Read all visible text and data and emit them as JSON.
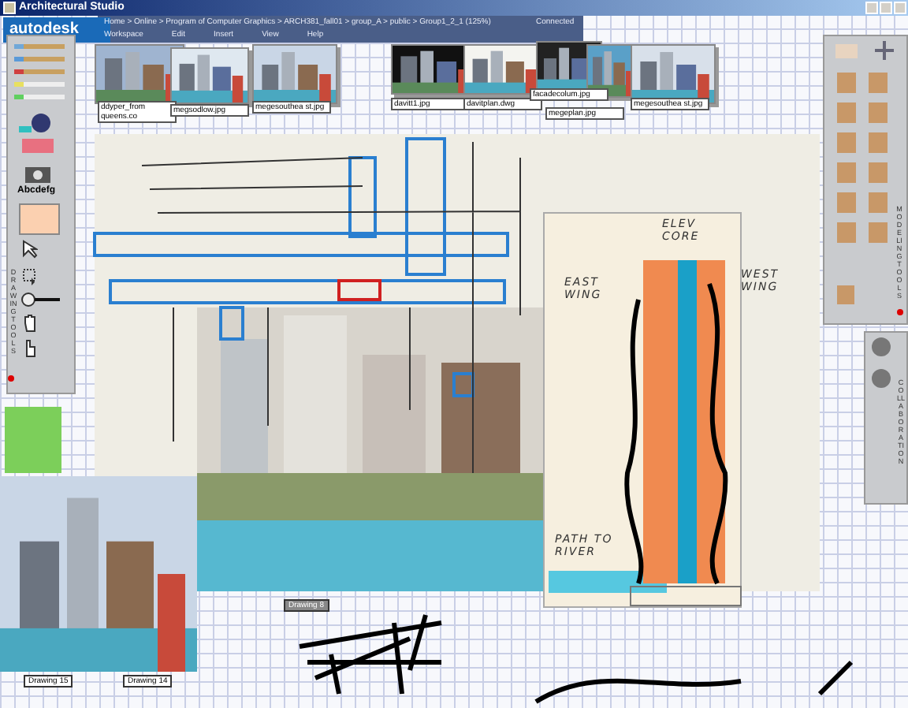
{
  "window": {
    "title": "Architectural Studio"
  },
  "header": {
    "logo": "autodesk",
    "breadcrumb": "Home > Online > Program of Computer Graphics > ARCH381_fall01 > group_A > public > Group1_2_1 (125%)",
    "status": "Connected",
    "menu": [
      "Workspace",
      "Edit",
      "Insert",
      "View",
      "Help"
    ]
  },
  "thumbnails": [
    {
      "label": "ddyper_from queens.co"
    },
    {
      "label": "megsodlow.jpg"
    },
    {
      "label": "megesouthea st.jpg"
    },
    {
      "label": "davitt1.jpg"
    },
    {
      "label": "davitplan.dwg"
    },
    {
      "label": "facadecolum.jpg"
    },
    {
      "label": "megeplan.jpg"
    },
    {
      "label": "megesouthea st.jpg"
    }
  ],
  "drawing_tools": {
    "title": "DRAWING TOOLS",
    "text_tool": "Abcdefg"
  },
  "modeling_tools": {
    "title": "MODELING TOOLS"
  },
  "collaboration": {
    "title": "COLLABORATION"
  },
  "sketch_notes": [
    {
      "text": "ELEV CORE"
    },
    {
      "text": "EAST WING"
    },
    {
      "text": "WEST WING"
    },
    {
      "text": "PATH TO RIVER"
    }
  ],
  "drawings": [
    {
      "label": "Drawing 15"
    },
    {
      "label": "Drawing 14"
    },
    {
      "label": "Drawing 8"
    }
  ]
}
